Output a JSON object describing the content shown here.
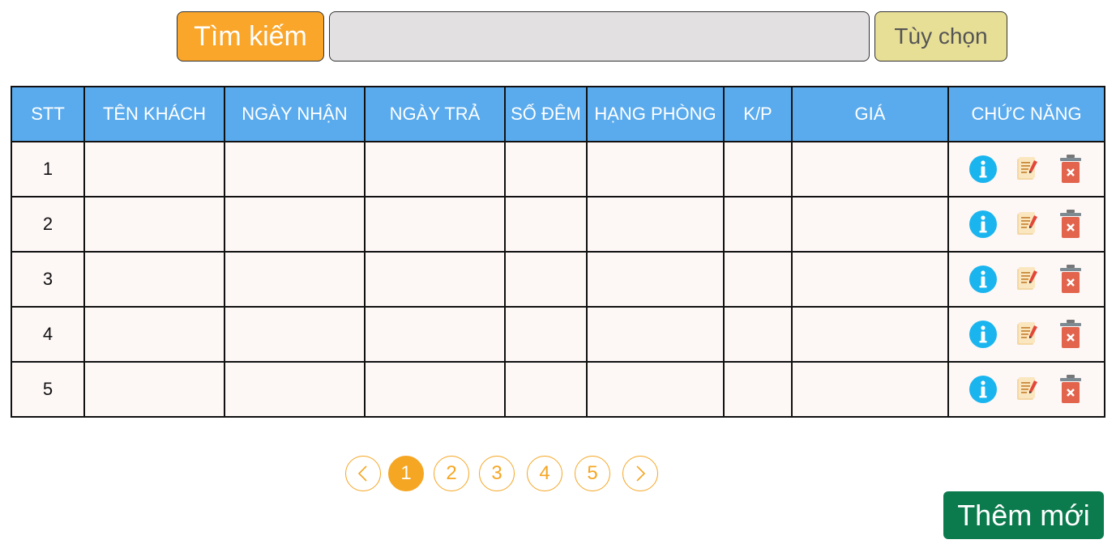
{
  "search": {
    "button_label": "Tìm kiếm",
    "input_value": "",
    "input_placeholder": "",
    "options_label": "Tùy chọn"
  },
  "table": {
    "headers": [
      "STT",
      "TÊN KHÁCH",
      "NGÀY NHẬN",
      "NGÀY TRẢ",
      "SỐ ĐÊM",
      "HẠNG PHÒNG",
      "K/P",
      "GIÁ",
      "CHỨC NĂNG"
    ],
    "rows": [
      {
        "stt": "1",
        "ten_khach": "",
        "ngay_nhan": "",
        "ngay_tra": "",
        "so_dem": "",
        "hang_phong": "",
        "kp": "",
        "gia": ""
      },
      {
        "stt": "2",
        "ten_khach": "",
        "ngay_nhan": "",
        "ngay_tra": "",
        "so_dem": "",
        "hang_phong": "",
        "kp": "",
        "gia": ""
      },
      {
        "stt": "3",
        "ten_khach": "",
        "ngay_nhan": "",
        "ngay_tra": "",
        "so_dem": "",
        "hang_phong": "",
        "kp": "",
        "gia": ""
      },
      {
        "stt": "4",
        "ten_khach": "",
        "ngay_nhan": "",
        "ngay_tra": "",
        "so_dem": "",
        "hang_phong": "",
        "kp": "",
        "gia": ""
      },
      {
        "stt": "5",
        "ten_khach": "",
        "ngay_nhan": "",
        "ngay_tra": "",
        "so_dem": "",
        "hang_phong": "",
        "kp": "",
        "gia": ""
      }
    ],
    "row_actions": [
      "info-icon",
      "edit-note-icon",
      "trash-icon"
    ]
  },
  "pagination": {
    "prev_icon": "chevron-left-icon",
    "next_icon": "chevron-right-icon",
    "pages": [
      "1",
      "2",
      "3",
      "4",
      "5"
    ],
    "current_page": "1"
  },
  "add_button_label": "Thêm mới",
  "colors": {
    "search_button": "#f9a62a",
    "options_button": "#e8df96",
    "table_header": "#5aabed",
    "table_cell": "#fdf7f6",
    "pager_accent": "#f5a623",
    "add_button": "#0b7a4d",
    "info_icon": "#1ab5ef",
    "trash_icon": "#e2644c"
  }
}
